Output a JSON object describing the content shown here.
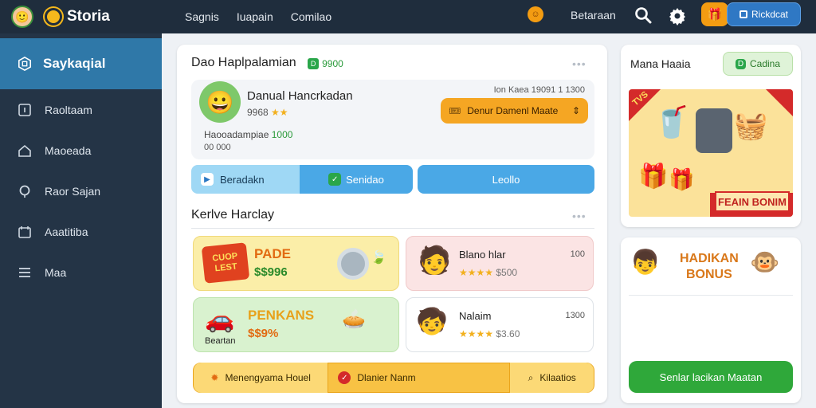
{
  "header": {
    "brand": "Storia",
    "nav": [
      "Sagnis",
      "Iuapain",
      "Comilao"
    ],
    "right_label": "Betaraan",
    "action_button": "Rickdcat"
  },
  "sidebar": {
    "active": "Saykaqial",
    "items": [
      "Raoltaam",
      "Maoeada",
      "Raor Sajan",
      "Aaatitiba",
      "Maa"
    ]
  },
  "main": {
    "section1_title": "Dao Haplpalamian",
    "section1_tag": "9900",
    "profile": {
      "name": "Danual Hancrkadan",
      "stars_text": "9968",
      "right_text": "Ion Kaea 19091 1 1300",
      "orange_button": "Denur Damenl Maate",
      "sub_label": "Haooadampiae",
      "sub_value": "1000",
      "sub2": "00 000"
    },
    "seg_buttons": [
      "Beradakn",
      "Senidao",
      "Leollo"
    ],
    "section2_title": "Kerlve Harclay",
    "tiles": [
      {
        "title": "PADE",
        "badge": "CUOP LEST",
        "price": "$$996"
      },
      {
        "name": "Blano hlar",
        "rating_value": "100",
        "value": "$500"
      },
      {
        "title": "PENKANS",
        "price": "$$9%",
        "caption": "Beartan"
      },
      {
        "name": "Nalaim",
        "rating_value": "1300",
        "value": "$3.60"
      }
    ],
    "bottom_buttons": [
      "Menengyama Houel",
      "Dlanier Nanm",
      "Kilaatios"
    ]
  },
  "right": {
    "label": "Mana Haaia",
    "button": "Cadina",
    "promo_label": "FEAIN BONIM",
    "promo_corner": "TVS",
    "bonus_title_1": "HADIKAN",
    "bonus_title_2": "BONUS",
    "green_button": "Senlar lacikan Maatan"
  }
}
